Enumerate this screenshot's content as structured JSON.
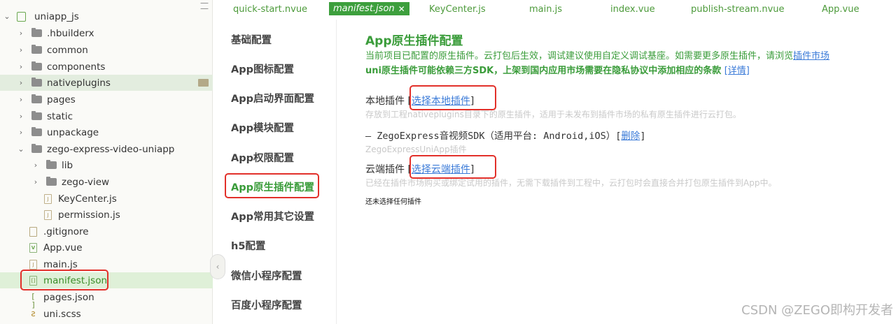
{
  "tree": {
    "root": "uniapp_js",
    "items": [
      {
        "label": ".hbuilderx"
      },
      {
        "label": "common"
      },
      {
        "label": "components"
      },
      {
        "label": "nativeplugins"
      },
      {
        "label": "pages"
      },
      {
        "label": "static"
      },
      {
        "label": "unpackage"
      },
      {
        "label": "zego-express-video-uniapp"
      },
      {
        "label": "lib"
      },
      {
        "label": "zego-view"
      },
      {
        "label": "KeyCenter.js"
      },
      {
        "label": "permission.js"
      },
      {
        "label": ".gitignore"
      },
      {
        "label": "App.vue"
      },
      {
        "label": "main.js"
      },
      {
        "label": "manifest.json"
      },
      {
        "label": "pages.json"
      },
      {
        "label": "uni.scss"
      }
    ]
  },
  "tabs": [
    {
      "label": "quick-start.nvue"
    },
    {
      "label": "manifest.json"
    },
    {
      "label": "KeyCenter.js"
    },
    {
      "label": "main.js"
    },
    {
      "label": "index.vue"
    },
    {
      "label": "publish-stream.nvue"
    },
    {
      "label": "App.vue"
    }
  ],
  "tab_close": "✕",
  "nav": [
    {
      "label": "基础配置"
    },
    {
      "label": "App图标配置"
    },
    {
      "label": "App启动界面配置"
    },
    {
      "label": "App模块配置"
    },
    {
      "label": "App权限配置"
    },
    {
      "label": "App原生插件配置"
    },
    {
      "label": "App常用其它设置"
    },
    {
      "label": "h5配置"
    },
    {
      "label": "微信小程序配置"
    },
    {
      "label": "百度小程序配置"
    }
  ],
  "main": {
    "title": "App原生插件配置",
    "desc_text": "当前项目已配置的原生插件。云打包后生效，调试建议使用自定义调试基座。如需要更多原生插件，请浏览",
    "desc_link": "插件市场",
    "desc2_text": "uni原生插件可能依赖三方SDK，上架到国内应用市场需要在隐私协议中添加相应的条款",
    "desc2_link": "[详情]",
    "local": {
      "label": "本地插件",
      "bracket_open": "[",
      "link": "选择本地插件",
      "bracket_close": "]",
      "hint": "存放到工程nativeplugins目录下的原生插件，适用于未发布到插件市场的私有原生插件进行云打包。"
    },
    "plugin": {
      "text": "– ZegoExpress音视频SDK（适用平台: Android,iOS）[",
      "link": "删除",
      "close": "]",
      "sub": "ZegoExpressUniApp插件"
    },
    "cloud": {
      "label": "云端插件",
      "bracket_open": "[",
      "link": "选择云端插件",
      "bracket_close": "]",
      "hint": "已经在插件市场购买或绑定试用的插件，无需下载插件到工程中，云打包时会直接合并打包原生插件到App中。"
    },
    "none_text": "还未选择任何插件"
  },
  "watermark": "CSDN @ZEGO即构开发者",
  "colors": {
    "accent": "#3a9c3a",
    "link": "#3b7bd8",
    "highlight": "#e2302a"
  }
}
